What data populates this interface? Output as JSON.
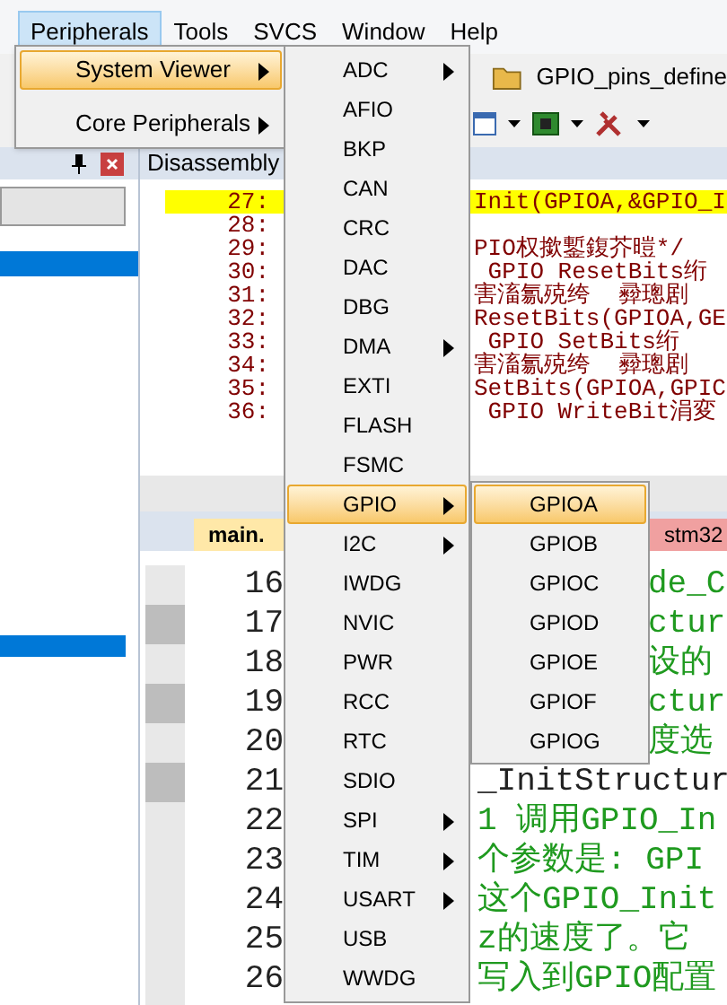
{
  "menubar": [
    {
      "label": "Peripherals",
      "selected": true
    },
    {
      "label": "Tools",
      "selected": false
    },
    {
      "label": "SVCS",
      "selected": false
    },
    {
      "label": "Window",
      "selected": false
    },
    {
      "label": "Help",
      "selected": false
    }
  ],
  "toolbar": {
    "target": "GPIO_pins_define"
  },
  "disassembly": {
    "title": "Disassembly",
    "lines": [
      {
        "number": "27:",
        "text": "Init(GPIOA,&GPIO_I",
        "current": true
      },
      {
        "number": "28:",
        "current": false
      },
      {
        "number": "29:",
        "text": "PIO权撳鏨鍑芥暟*/",
        "current": false
      },
      {
        "number": "30:",
        "text": " GPIO ResetBits绗",
        "current": false
      },
      {
        "number": "31:",
        "text": "害滀氱殑绔  彛璁剧",
        "current": false
      },
      {
        "number": "32:",
        "text": "ResetBits(GPIOA,GE",
        "current": false
      },
      {
        "number": "33:",
        "text": " GPIO SetBits绗  ",
        "current": false
      },
      {
        "number": "34:",
        "text": "害滀氱殑绔  彛璁剧",
        "current": false
      },
      {
        "number": "35:",
        "text": "SetBits(GPIOA,GPIC",
        "current": false
      },
      {
        "number": "36:",
        "text": " GPIO WriteBit涓変",
        "current": false
      }
    ]
  },
  "editor": {
    "tabs": [
      {
        "label": "main.",
        "selected": true
      },
      {
        "label": "stm32",
        "selected": false
      }
    ],
    "lines": [
      {
        "number": "16",
        "text": "de_C",
        "kind": "comment",
        "covered": true,
        "marker": false
      },
      {
        "number": "17",
        "text": "ctur",
        "kind": "comment",
        "covered": true,
        "marker": true
      },
      {
        "number": "18",
        "text": "设的",
        "kind": "comment",
        "covered": true,
        "marker": false
      },
      {
        "number": "19",
        "text": "ctur",
        "kind": "comment",
        "covered": true,
        "marker": true
      },
      {
        "number": "20",
        "text": "度选",
        "kind": "comment",
        "covered": true,
        "marker": false
      },
      {
        "number": "21",
        "text": "_InitStructur",
        "kind": "code",
        "covered": false,
        "marker": true
      },
      {
        "number": "22",
        "text": "1 调用GPIO_In",
        "kind": "comment",
        "covered": false,
        "marker": false
      },
      {
        "number": "23",
        "text": "个参数是: GPI",
        "kind": "comment",
        "covered": false,
        "marker": false
      },
      {
        "number": "24",
        "text": "这个GPIO_Init",
        "kind": "comment",
        "covered": false,
        "marker": false
      },
      {
        "number": "25",
        "text": "z的速度了。它",
        "kind": "comment",
        "covered": false,
        "marker": false
      },
      {
        "number": "26",
        "text": "写入到GPIO配置",
        "kind": "comment",
        "covered": false,
        "marker": false
      }
    ]
  },
  "peripherals_menu": {
    "items": [
      {
        "label": "System Viewer",
        "submenu": true,
        "selected": true
      },
      {
        "label": "Core Peripherals",
        "submenu": true,
        "selected": false
      }
    ]
  },
  "system_viewer_menu": {
    "items": [
      {
        "label": "ADC",
        "submenu": true,
        "selected": false
      },
      {
        "label": "AFIO",
        "submenu": false,
        "selected": false
      },
      {
        "label": "BKP",
        "submenu": false,
        "selected": false
      },
      {
        "label": "CAN",
        "submenu": false,
        "selected": false
      },
      {
        "label": "CRC",
        "submenu": false,
        "selected": false
      },
      {
        "label": "DAC",
        "submenu": false,
        "selected": false
      },
      {
        "label": "DBG",
        "submenu": false,
        "selected": false
      },
      {
        "label": "DMA",
        "submenu": true,
        "selected": false
      },
      {
        "label": "EXTI",
        "submenu": false,
        "selected": false
      },
      {
        "label": "FLASH",
        "submenu": false,
        "selected": false
      },
      {
        "label": "FSMC",
        "submenu": false,
        "selected": false
      },
      {
        "label": "GPIO",
        "submenu": true,
        "selected": true
      },
      {
        "label": "I2C",
        "submenu": true,
        "selected": false
      },
      {
        "label": "IWDG",
        "submenu": false,
        "selected": false
      },
      {
        "label": "NVIC",
        "submenu": false,
        "selected": false
      },
      {
        "label": "PWR",
        "submenu": false,
        "selected": false
      },
      {
        "label": "RCC",
        "submenu": false,
        "selected": false
      },
      {
        "label": "RTC",
        "submenu": false,
        "selected": false
      },
      {
        "label": "SDIO",
        "submenu": false,
        "selected": false
      },
      {
        "label": "SPI",
        "submenu": true,
        "selected": false
      },
      {
        "label": "TIM",
        "submenu": true,
        "selected": false
      },
      {
        "label": "USART",
        "submenu": true,
        "selected": false
      },
      {
        "label": "USB",
        "submenu": false,
        "selected": false
      },
      {
        "label": "WWDG",
        "submenu": false,
        "selected": false
      }
    ]
  },
  "gpio_menu": {
    "items": [
      {
        "label": "GPIOA",
        "selected": true
      },
      {
        "label": "GPIOB",
        "selected": false
      },
      {
        "label": "GPIOC",
        "selected": false
      },
      {
        "label": "GPIOD",
        "selected": false
      },
      {
        "label": "GPIOE",
        "selected": false
      },
      {
        "label": "GPIOF",
        "selected": false
      },
      {
        "label": "GPIOG",
        "selected": false
      }
    ]
  }
}
